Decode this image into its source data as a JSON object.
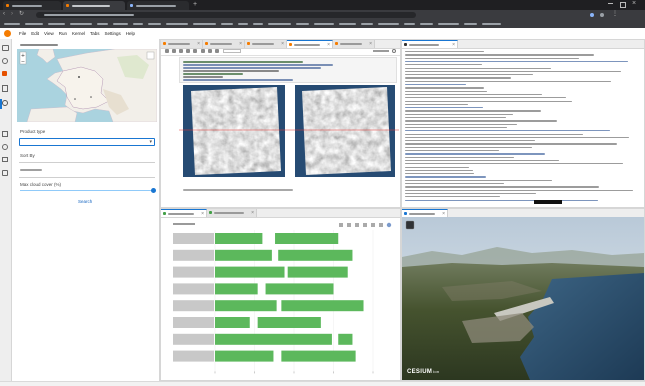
{
  "browser": {
    "new_tab_icon": "plus-icon",
    "nav_icons": [
      "back-icon",
      "forward-icon",
      "reload-icon"
    ],
    "window_icons": [
      "minimize-icon",
      "maximize-icon",
      "close-icon"
    ]
  },
  "jupyter": {
    "menu": [
      "File",
      "Edit",
      "View",
      "Run",
      "Kernel",
      "Tabs",
      "Settings",
      "Help"
    ]
  },
  "left_panel": {
    "product_type_label": "Product type",
    "sort_by_label": "Sort By",
    "cloud_cover_label": "Max cloud cover (%)",
    "cloud_cover_level": 1.0,
    "search_label": "Search"
  },
  "cesium": {
    "logo_main": "CESIUM",
    "logo_sub": "ion"
  },
  "colors": {
    "accent": "#1976d2",
    "notebook_icon": "#f57c00",
    "bar_green": "#5cb85c",
    "row_label_grey": "#c8c8c8",
    "sar_background": "#264b73",
    "profile_line": "#e53935"
  },
  "chart_data": {
    "type": "bar",
    "orientation": "horizontal",
    "xlim": [
      0,
      100
    ],
    "rows": [
      {
        "segments": [
          [
            0,
            30
          ],
          [
            38,
            78
          ]
        ]
      },
      {
        "segments": [
          [
            0,
            36
          ],
          [
            40,
            87
          ]
        ]
      },
      {
        "segments": [
          [
            0,
            44
          ],
          [
            46,
            84
          ]
        ]
      },
      {
        "segments": [
          [
            0,
            27
          ],
          [
            32,
            75
          ]
        ]
      },
      {
        "segments": [
          [
            0,
            39
          ],
          [
            42,
            94
          ]
        ]
      },
      {
        "segments": [
          [
            0,
            22
          ],
          [
            27,
            67
          ]
        ]
      },
      {
        "segments": [
          [
            0,
            74
          ],
          [
            78,
            87
          ]
        ]
      },
      {
        "segments": [
          [
            0,
            37
          ],
          [
            42,
            89
          ]
        ]
      }
    ]
  }
}
